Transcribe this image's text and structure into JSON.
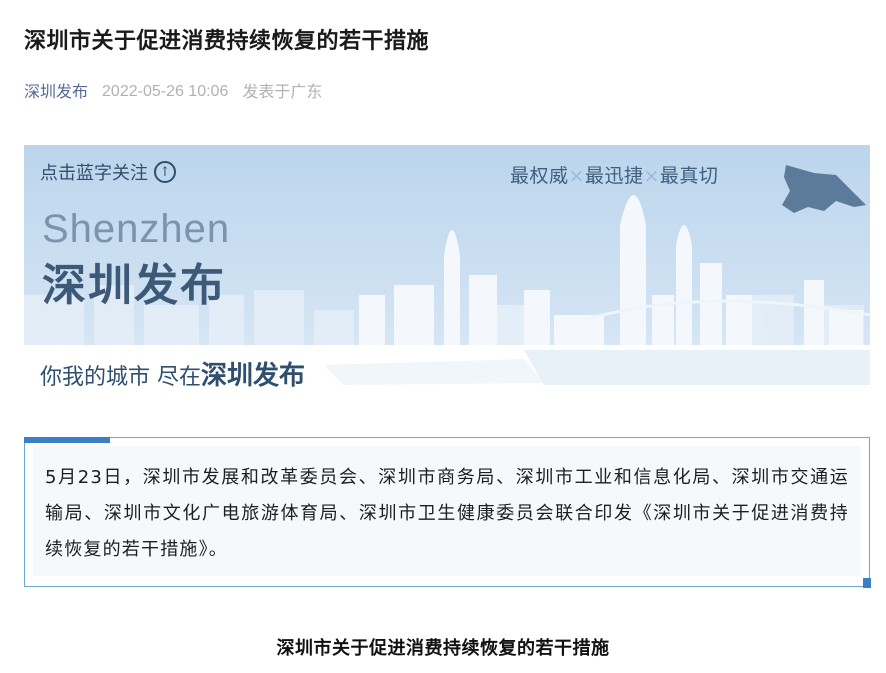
{
  "article": {
    "title": "深圳市关于促进消费持续恢复的若干措施",
    "author": "深圳发布",
    "date": "2022-05-26 10:06",
    "location": "发表于广东"
  },
  "banner": {
    "follow_text": "点击蓝字关注",
    "slogan": [
      "最权威",
      "最迅捷",
      "最真切"
    ],
    "slogan_sep": "×",
    "brand_en": "Shenzhen",
    "brand_cn": "深圳发布",
    "tagline_prefix": "你我的城市 尽在",
    "tagline_emphasis": "深圳发布"
  },
  "notice": {
    "text": "5月23日，深圳市发展和改革委员会、深圳市商务局、深圳市工业和信息化局、深圳市交通运输局、深圳市文化广电旅游体育局、深圳市卫生健康委员会联合印发《深圳市关于促进消费持续恢复的若干措施》。"
  },
  "subheading": "深圳市关于促进消费持续恢复的若干措施",
  "colors": {
    "author_link": "#576b95",
    "accent_blue": "#3b7fc9",
    "banner_sky": "#c9def1"
  }
}
